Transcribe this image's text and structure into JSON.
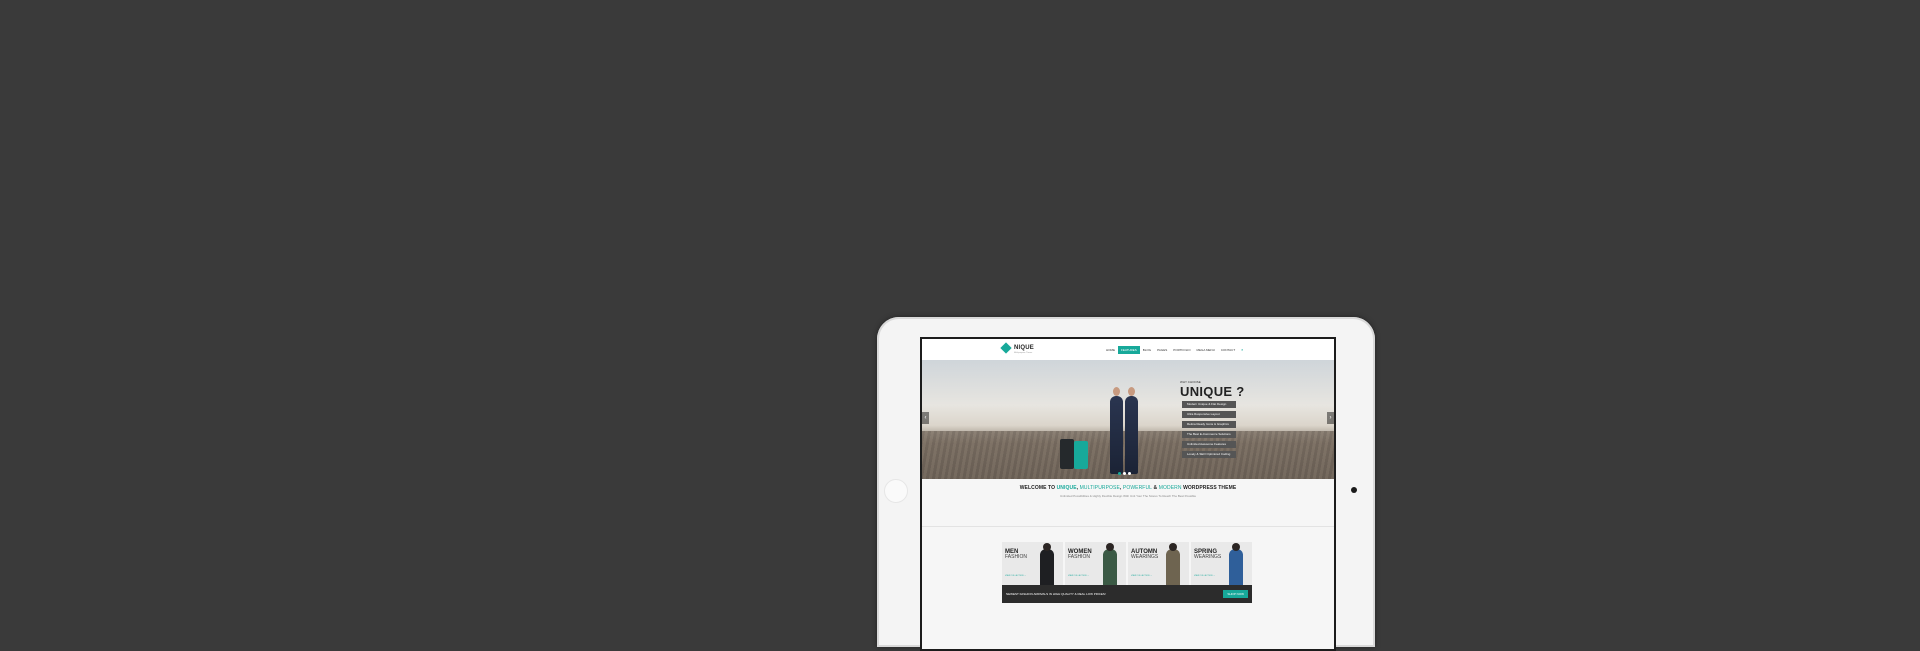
{
  "logo": {
    "text": "NIQUE",
    "tagline": "Multipurpose Theme"
  },
  "nav": {
    "items": [
      {
        "label": "Home",
        "active": false
      },
      {
        "label": "Features",
        "active": true
      },
      {
        "label": "Blog",
        "active": false
      },
      {
        "label": "Pages",
        "active": false
      },
      {
        "label": "Portfolio",
        "active": false
      },
      {
        "label": "Mega Menu",
        "active": false
      },
      {
        "label": "Contact",
        "active": false
      }
    ]
  },
  "hero": {
    "kicker": "WHY CHOOSE",
    "title": "UNIQUE ?",
    "features": [
      "Modern Unique & Flat Design",
      "Ultra Responsive Layout",
      "Retina Ready Icons & Graphics",
      "The Best E-Commerce Solutions",
      "Unlimited Awesome Features",
      "Lovely & SEO Optimized Coding"
    ],
    "slide_count": 3,
    "active_slide": 0
  },
  "welcome": {
    "prefix": "WELCOME TO",
    "brand": "UNIQUE",
    "sep1": ",",
    "word1": "MULTIPURPOSE",
    "sep2": ",",
    "word2": "POWERFUL",
    "sep3": "&",
    "word3": "MODERN",
    "suffix": "WORDPRESS THEME",
    "subtitle": "Unlimited Possibilities & Highly Flexible Design With Unit Your The Stores To Reach The Best Possible"
  },
  "categories": [
    {
      "title": "MEN",
      "subtitle": "FASHION",
      "link": "VIEW COLLECTION →"
    },
    {
      "title": "WOMEN",
      "subtitle": "FASHION",
      "link": "VIEW COLLECTION →"
    },
    {
      "title": "AUTOMN",
      "subtitle": "WEARINGS",
      "link": "VIEW COLLECTION →"
    },
    {
      "title": "SPRING",
      "subtitle": "WEARINGS",
      "link": "VIEW COLLECTION →"
    }
  ],
  "promo": {
    "text": "NEWEST FASHION ARRIVALS IN HIGH QUALITY & REAL LOW PRICES!",
    "button": "SHOP NOW"
  },
  "colors": {
    "accent": "#17a99a",
    "background": "#3a3a3a",
    "device": "#f4f4f4"
  }
}
